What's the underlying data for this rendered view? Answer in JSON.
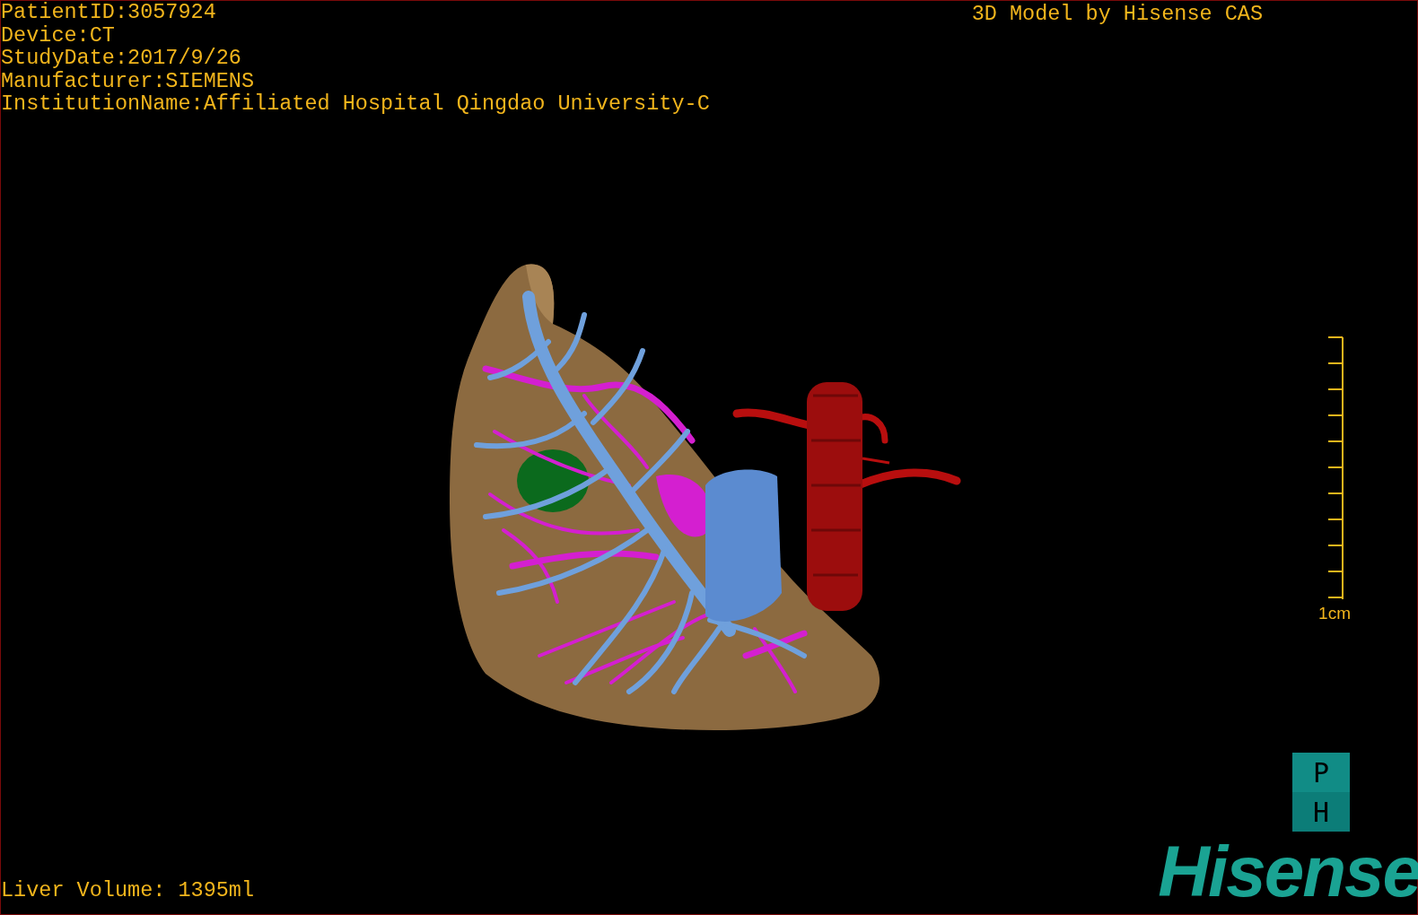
{
  "patient_info": [
    "PatientID:3057924",
    "Device:CT",
    "StudyDate:2017/9/26",
    "Manufacturer:SIEMENS",
    "InstitutionName:Affiliated Hospital Qingdao University-C"
  ],
  "title": "3D Model by Hisense CAS",
  "scale_bar": {
    "label": "1cm"
  },
  "orientation_marker": [
    "P",
    "H"
  ],
  "liver_volume": "Liver Volume: 1395ml",
  "logo": "Hisense"
}
